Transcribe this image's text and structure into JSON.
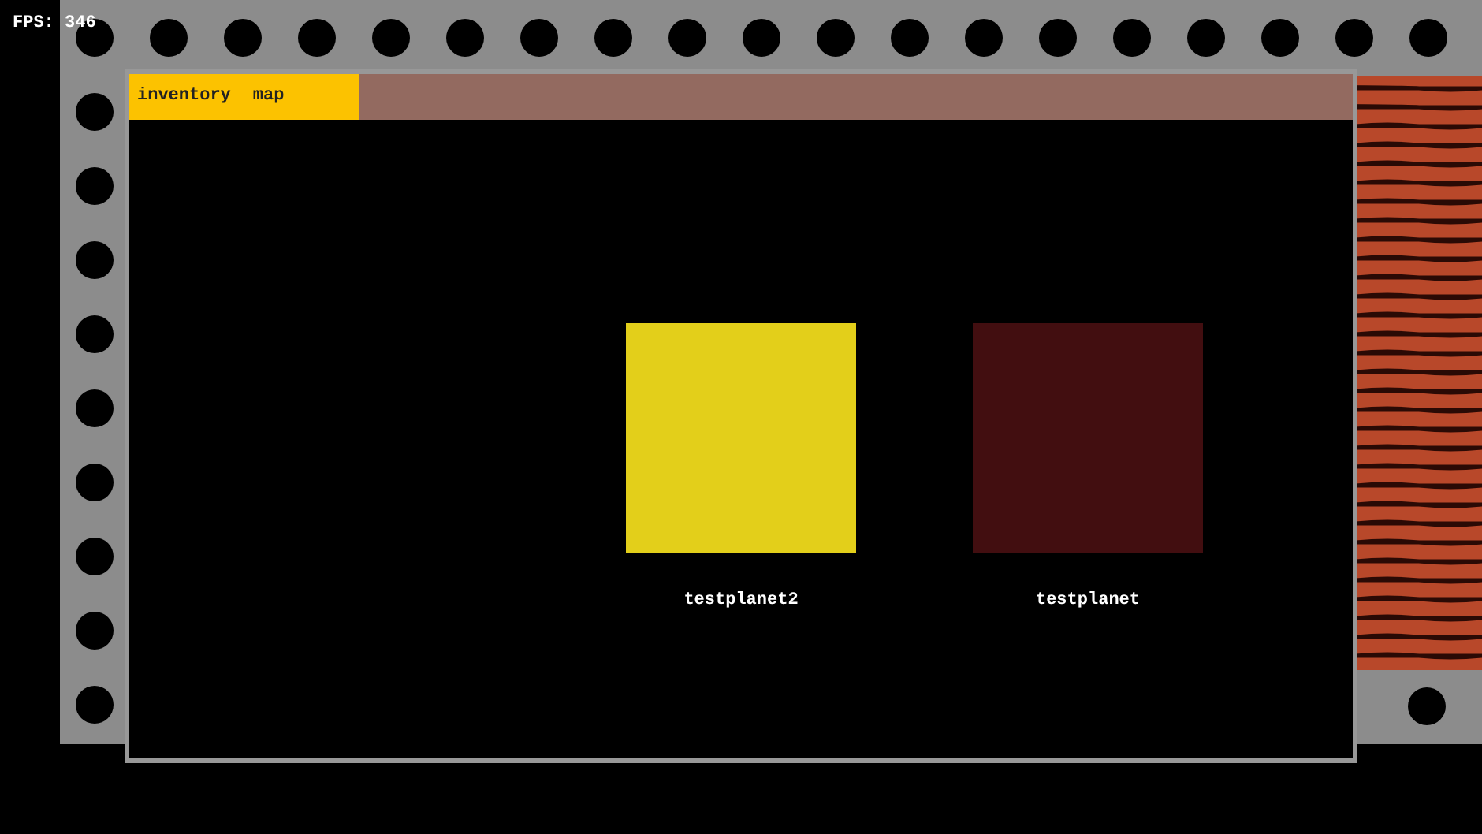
{
  "fps": "FPS: 346",
  "tabs": [
    {
      "label": "inventory"
    },
    {
      "label": "map"
    }
  ],
  "planets": [
    {
      "name": "testplanet2",
      "color": "#e3cf1a"
    },
    {
      "name": "testplanet",
      "color": "#420e10"
    }
  ]
}
